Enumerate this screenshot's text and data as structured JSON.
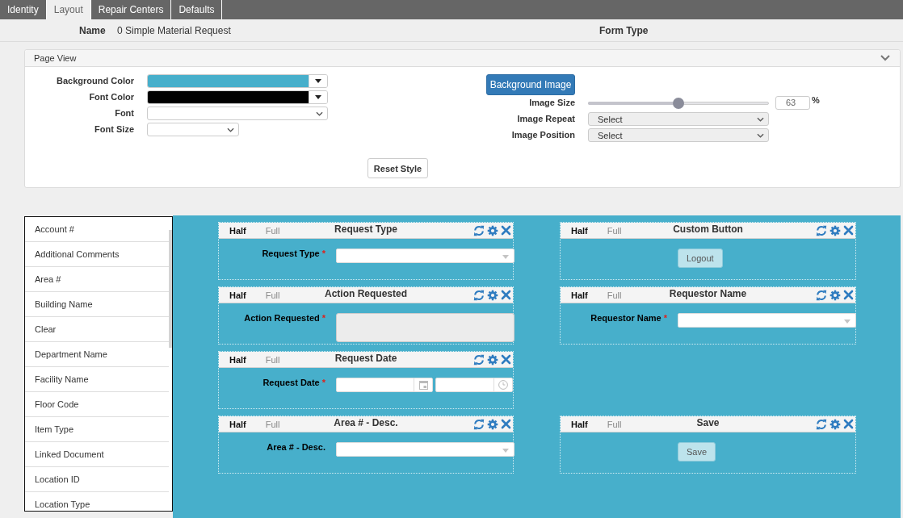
{
  "tabs": [
    {
      "label": "Identity",
      "selected": false
    },
    {
      "label": "Layout",
      "selected": true
    },
    {
      "label": "Repair Centers",
      "selected": false
    },
    {
      "label": "Defaults",
      "selected": false
    }
  ],
  "form_info": {
    "name_label": "Name",
    "name_value": "0 Simple Material Request",
    "form_type_label": "Form Type"
  },
  "page_view": {
    "title": "Page View",
    "expanded": true,
    "style_fields": [
      {
        "kind": "color",
        "label": "Background Color",
        "color": "#47afcb"
      },
      {
        "kind": "color",
        "label": "Font Color",
        "color": "#000000"
      },
      {
        "kind": "select",
        "label": "Font"
      },
      {
        "kind": "compact",
        "label": "Font Size"
      }
    ],
    "background_image_button": "Background Image",
    "image_fields": [
      {
        "kind": "slider",
        "label": "Image Size",
        "level": 0.5,
        "value": "63",
        "unit": "%"
      },
      {
        "kind": "select",
        "label": "Image Repeat",
        "value": "Select"
      },
      {
        "kind": "select",
        "label": "Image Position",
        "value": "Select"
      }
    ],
    "reset_button": "Reset Style"
  },
  "field_list": {
    "items": [
      "Account #",
      "Additional Comments",
      "Area #",
      "Building Name",
      "Clear",
      "Department Name",
      "Facility Name",
      "Floor Code",
      "Item Type",
      "Linked Document",
      "Location ID",
      "Location Type"
    ]
  },
  "canvas": {
    "rows": [
      {
        "left": {
          "size_options": [
            {
              "label": "Half",
              "selected": true
            },
            {
              "label": "Full",
              "selected": false
            }
          ],
          "title": "Request Type",
          "field": {
            "kind": "select",
            "label": "Request Type",
            "required_mark": "*"
          }
        },
        "right": {
          "size_options": [
            {
              "label": "Half",
              "selected": true
            },
            {
              "label": "Full",
              "selected": false
            }
          ],
          "title": "Custom Button",
          "field": {
            "kind": "button",
            "button_label": "Logout"
          }
        }
      },
      {
        "left": {
          "size_options": [
            {
              "label": "Half",
              "selected": true
            },
            {
              "label": "Full",
              "selected": false
            }
          ],
          "title": "Action Requested",
          "field": {
            "kind": "textarea",
            "label": "Action Requested",
            "required_mark": "*"
          }
        },
        "right": {
          "size_options": [
            {
              "label": "Half",
              "selected": true
            },
            {
              "label": "Full",
              "selected": false
            }
          ],
          "title": "Requestor Name",
          "field": {
            "kind": "select",
            "label": "Requestor Name",
            "required_mark": "*"
          }
        }
      },
      {
        "left": {
          "size_options": [
            {
              "label": "Half",
              "selected": true
            },
            {
              "label": "Full",
              "selected": false
            }
          ],
          "title": "Request Date",
          "field": {
            "kind": "datetime",
            "label": "Request Date",
            "required_mark": "*"
          }
        }
      },
      {
        "left": {
          "size_options": [
            {
              "label": "Half",
              "selected": true
            },
            {
              "label": "Full",
              "selected": false
            }
          ],
          "title": "Area # - Desc.",
          "field": {
            "kind": "select",
            "label": "Area # - Desc."
          }
        },
        "right": {
          "size_options": [
            {
              "label": "Half",
              "selected": true
            },
            {
              "label": "Full",
              "selected": false
            }
          ],
          "title": "Save",
          "field": {
            "kind": "button",
            "button_label": "Save"
          }
        }
      }
    ]
  }
}
